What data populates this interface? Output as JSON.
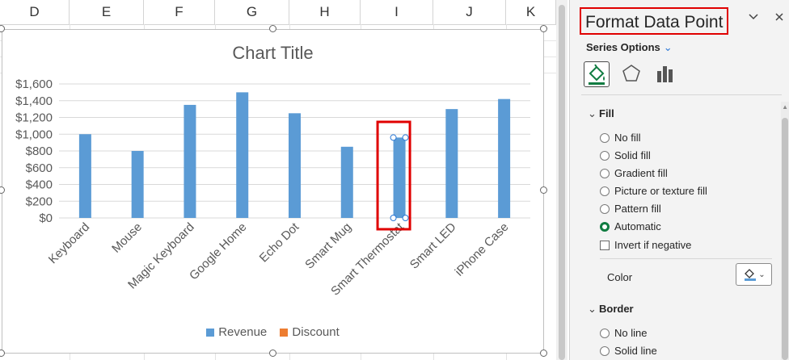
{
  "sheet": {
    "columns": [
      "D",
      "E",
      "F",
      "G",
      "H",
      "I",
      "J",
      "K"
    ]
  },
  "chart": {
    "title": "Chart Title",
    "legend": [
      "Revenue",
      "Discount"
    ]
  },
  "chart_data": {
    "type": "bar",
    "title": "Chart Title",
    "xlabel": "",
    "ylabel": "",
    "categories": [
      "Keyboard",
      "Mouse",
      "Magic Keyboard",
      "Google Home",
      "Echo Dot",
      "Smart Mug",
      "Smart Thermostat",
      "Smart LED",
      "iPhone Case"
    ],
    "series": [
      {
        "name": "Revenue",
        "values": [
          1000,
          800,
          1350,
          1500,
          1250,
          850,
          960,
          1300,
          1420
        ],
        "color": "#5b9bd5"
      },
      {
        "name": "Discount",
        "values": [
          0,
          0,
          0,
          0,
          0,
          0,
          0,
          0,
          0
        ],
        "color": "#ed7d31"
      }
    ],
    "ylim": [
      0,
      1600
    ],
    "yticks": [
      "$0",
      "$200",
      "$400",
      "$600",
      "$800",
      "$1,000",
      "$1,200",
      "$1,400",
      "$1,600"
    ],
    "grid": true,
    "legend_position": "bottom",
    "selected_point": "Smart Thermostat"
  },
  "pane": {
    "title": "Format Data Point",
    "collapse_icon": "chevron-down-icon",
    "close_icon": "close-icon",
    "series_options_label": "Series Options",
    "tabs": [
      {
        "name": "fill-line-icon"
      },
      {
        "name": "effects-icon"
      },
      {
        "name": "series-options-icon"
      }
    ],
    "fill": {
      "label": "Fill",
      "options": [
        "No fill",
        "Solid fill",
        "Gradient fill",
        "Picture or texture fill",
        "Pattern fill",
        "Automatic"
      ],
      "selected": "Automatic",
      "invert_label": "Invert if negative",
      "color_label": "Color"
    },
    "border": {
      "label": "Border",
      "options": [
        "No line",
        "Solid line"
      ]
    }
  },
  "colors": {
    "accent": "#107c41",
    "highlight": "#e00000",
    "revenue": "#5b9bd5",
    "discount": "#ed7d31"
  }
}
